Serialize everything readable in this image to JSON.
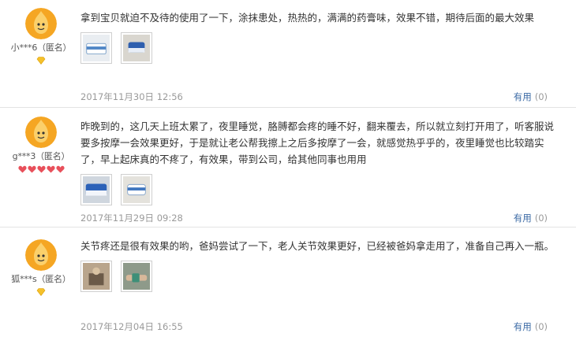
{
  "reviews": [
    {
      "user": "小***6（匿名）",
      "text": "拿到宝贝就迫不及待的使用了一下，涂抹患处，热热的，满满的药膏味，效果不错，期待后面的最大效果",
      "date": "2017年11月30日 12:56",
      "useful_label": "有用",
      "useful_count": "(0)",
      "badge": "single"
    },
    {
      "user": "g***3（匿名）",
      "text": "昨晚到的，这几天上班太累了，夜里睡觉，胳膊都会疼的睡不好，翻来覆去，所以就立刻打开用了，听客服说要多按摩一会效果更好，于是就让老公帮我擦上之后多按摩了一会，就感觉热乎乎的，夜里睡觉也比较踏实了，早上起床真的不疼了，有效果，带到公司，给其他同事也用用",
      "date": "2017年11月29日 09:28",
      "useful_label": "有用",
      "useful_count": "(0)",
      "badge": "hearts"
    },
    {
      "user": "狐***s（匿名）",
      "text": "关节疼还是很有效果的哟，爸妈尝试了一下，老人关节效果更好，已经被爸妈拿走用了，准备自己再入一瓶。",
      "date": "2017年12月04日 16:55",
      "useful_label": "有用",
      "useful_count": "(0)",
      "badge": "single"
    }
  ],
  "colors": {
    "avatar_orange": "#f5a623",
    "link": "#3b6aa5",
    "meta": "#9a9a9a",
    "separator": "#e3e3e3",
    "heart_red": "#e8505b"
  }
}
